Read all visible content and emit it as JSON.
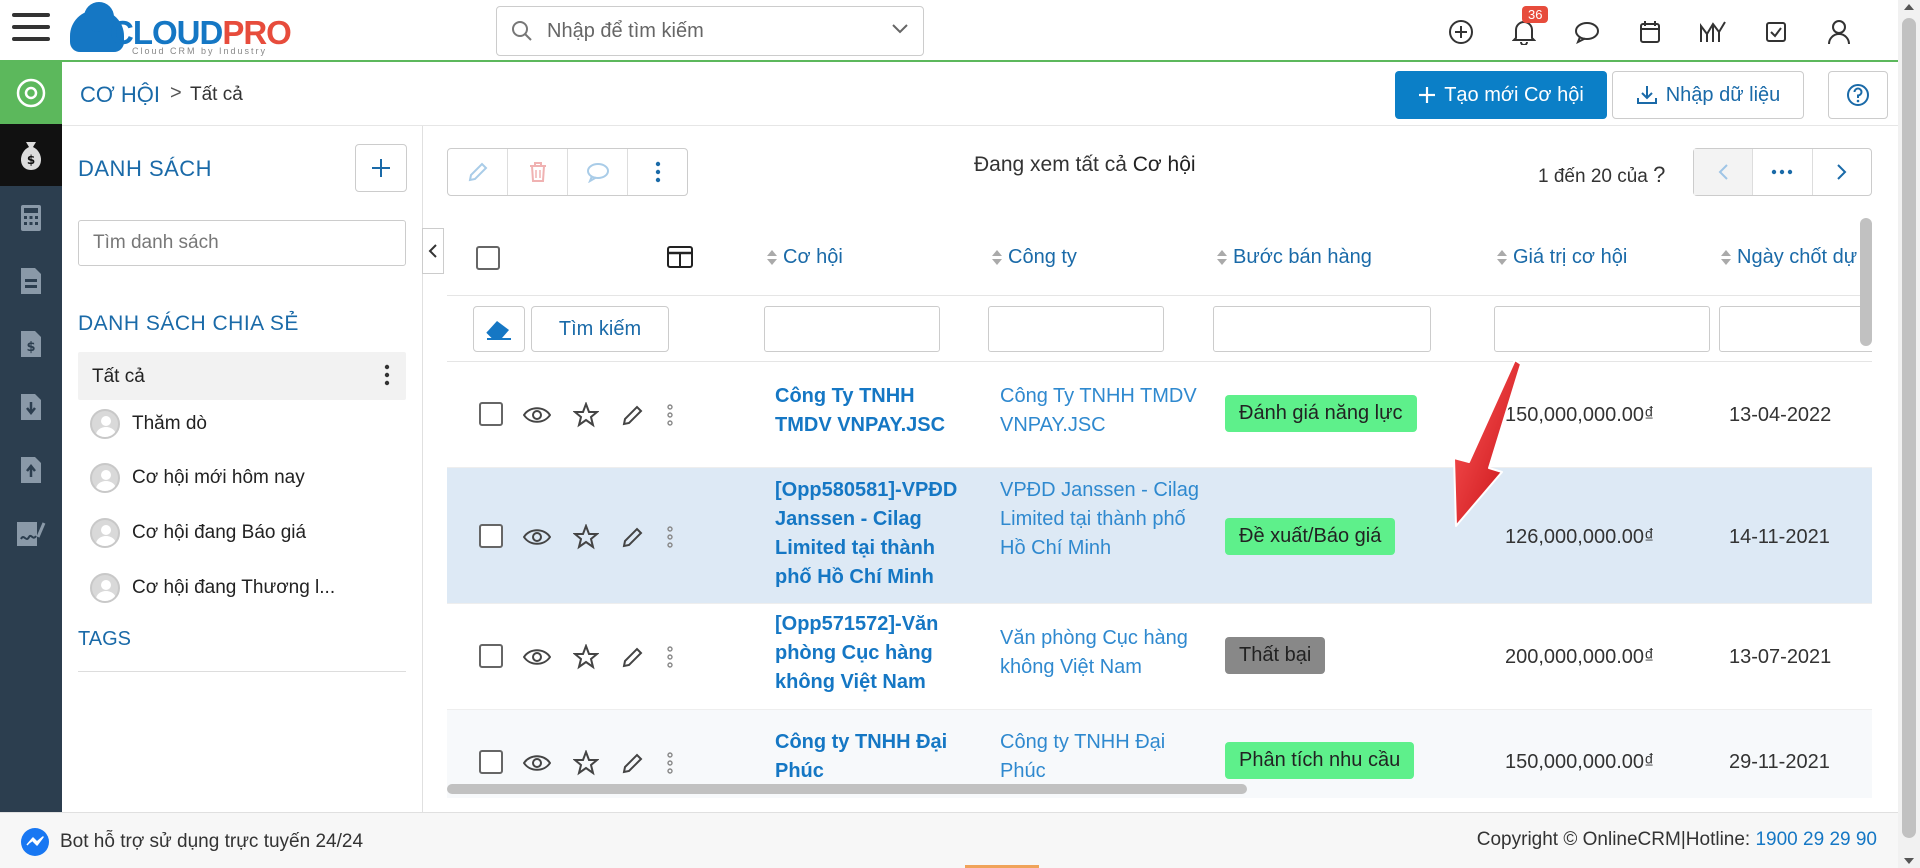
{
  "header": {
    "logo_text_a": "CLOUD",
    "logo_text_b": "PRO",
    "logo_tagline": "Cloud CRM by Industry",
    "search_placeholder": "Nhập để tìm kiếm",
    "notification_count": "36"
  },
  "breadcrumb": {
    "module": "CƠ HỘI",
    "separator": ">",
    "current": "Tất cả"
  },
  "actions": {
    "create_label": "Tạo mới Cơ hội",
    "import_label": "Nhập dữ liệu"
  },
  "listpanel": {
    "title": "DANH SÁCH",
    "search_placeholder": "Tìm danh sách",
    "shared_title": "DANH SÁCH CHIA SẺ",
    "all_label": "Tất cả",
    "items": [
      {
        "label": "Thăm dò"
      },
      {
        "label": "Cơ hội mới hôm nay"
      },
      {
        "label": "Cơ hội đang Báo giá"
      },
      {
        "label": "Cơ hội đang Thương l..."
      }
    ],
    "tags_title": "TAGS"
  },
  "main": {
    "viewing_prefix": "Đang xem tất cả",
    "viewing_module": "Cơ hội",
    "paging_text": "1 đến 20 của",
    "paging_unknown": "?",
    "filter_search_label": "Tìm kiếm",
    "columns": [
      "Cơ hội",
      "Công ty",
      "Bước bán hàng",
      "Giá trị cơ hội",
      "Ngày chốt dự"
    ],
    "rows": [
      {
        "opp": "Công Ty TNHH TMDV VNPAY.JSC",
        "company": "Công Ty TNHH TMDV VNPAY.JSC",
        "stage": "Đánh giá năng lực",
        "stage_color": "#5ef08b",
        "value": "150,000,000.00₫",
        "date": "13-04-2022"
      },
      {
        "opp": "[Opp580581]-VPĐD Janssen - Cilag Limited tại thành phố Hồ Chí Minh",
        "company": "VPĐD Janssen - Cilag Limited tại thành phố Hồ Chí Minh",
        "stage": "Đề xuất/Báo giá",
        "stage_color": "#5ef08b",
        "value": "126,000,000.00₫",
        "date": "14-11-2021"
      },
      {
        "opp": "[Opp571572]-Văn phòng Cục hàng không Việt Nam",
        "company": "Văn phòng Cục hàng không Việt Nam",
        "stage": "Thất bại",
        "stage_color": "#888888",
        "value": "200,000,000.00₫",
        "date": "13-07-2021"
      },
      {
        "opp": "Công ty TNHH Đại Phúc",
        "company": "Công ty TNHH Đại Phúc",
        "stage": "Phân tích nhu cầu",
        "stage_color": "#5ef08b",
        "value": "150,000,000.00₫",
        "date": "29-11-2021"
      }
    ]
  },
  "footer": {
    "bot_text": "Bot hỗ trợ sử dụng trực tuyến 24/24",
    "copyright": "Copyright © OnlineCRM",
    "separator": "|",
    "hotline_label": "Hotline:",
    "hotline": "1900 29 29 90"
  },
  "colors": {
    "brand_blue": "#1577c4",
    "primary_button": "#0b7fc7",
    "accent_green": "#5cb85c",
    "sidebar_dark": "#2c3e4f",
    "stage_green": "#5ef08b",
    "stage_gray": "#888888",
    "selected_row": "#dde9f5",
    "annotation_arrow": "#e8141b"
  }
}
